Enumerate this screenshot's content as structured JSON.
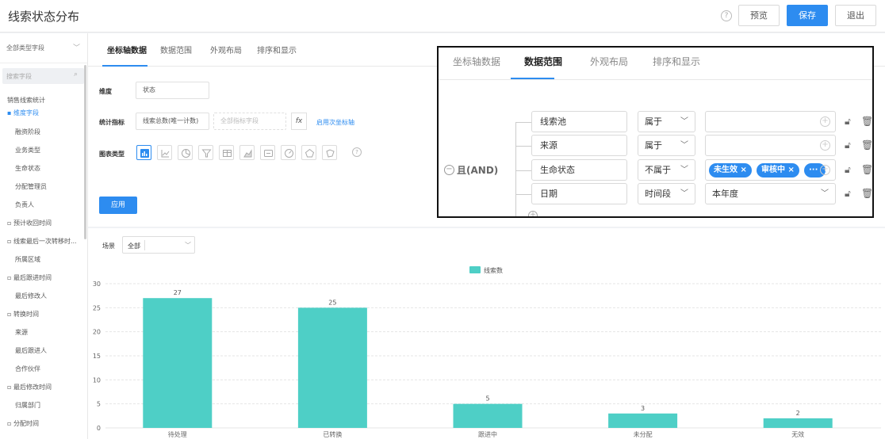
{
  "header": {
    "title": "线索状态分布",
    "preview": "预览",
    "save": "保存",
    "exit": "退出"
  },
  "sidebar": {
    "type_select": "全部类型字段",
    "search_placeholder": "搜索字段",
    "items": [
      "销售线索统计",
      "维度字段",
      "融资阶段",
      "业务类型",
      "生命状态",
      "分配管理员",
      "负责人",
      "预计收回时间",
      "线索最后一次转移时...",
      "所属区域",
      "最后跟进时间",
      "最后修改人",
      "转换时间",
      "来源",
      "最后跟进人",
      "合作伙伴",
      "最后修改时间",
      "归属部门",
      "分配时间"
    ]
  },
  "config": {
    "tabs": [
      "坐标轴数据",
      "数据范围",
      "外观布局",
      "排序和显示"
    ],
    "dimension_label": "维度",
    "dimension_value": "状态",
    "metric_label": "统计指标",
    "metric_value": "线索总数(唯一计数)",
    "metric_placeholder": "全部指标字段",
    "fx": "fx",
    "secondary_axis": "启用次坐标轴",
    "chart_type_label": "图表类型",
    "apply": "应用"
  },
  "scene": {
    "label": "场景",
    "value": "全部"
  },
  "filter_panel": {
    "tabs": [
      "坐标轴数据",
      "数据范围",
      "外观布局",
      "排序和显示"
    ],
    "logic": "且(AND)",
    "rows": [
      {
        "field": "线索池",
        "operator": "属于",
        "value": ""
      },
      {
        "field": "来源",
        "operator": "属于",
        "value": ""
      },
      {
        "field": "生命状态",
        "operator": "不属于",
        "tags": [
          "未生效 ×",
          "审核中 ×",
          "···"
        ]
      },
      {
        "field": "日期",
        "operator": "时间段",
        "value": "本年度"
      }
    ]
  },
  "chart_data": {
    "type": "bar",
    "legend": [
      "线索数"
    ],
    "categories": [
      "待处理",
      "已转换",
      "跟进中",
      "未分配",
      "无效"
    ],
    "series": [
      {
        "name": "线索数",
        "values": [
          27,
          25,
          5,
          3,
          2
        ]
      }
    ],
    "ylim": [
      0,
      30
    ],
    "yticks": [
      0,
      5,
      10,
      15,
      20,
      25,
      30
    ],
    "color": "#4ecfc6",
    "grid": true,
    "legend_position": "top-center"
  }
}
